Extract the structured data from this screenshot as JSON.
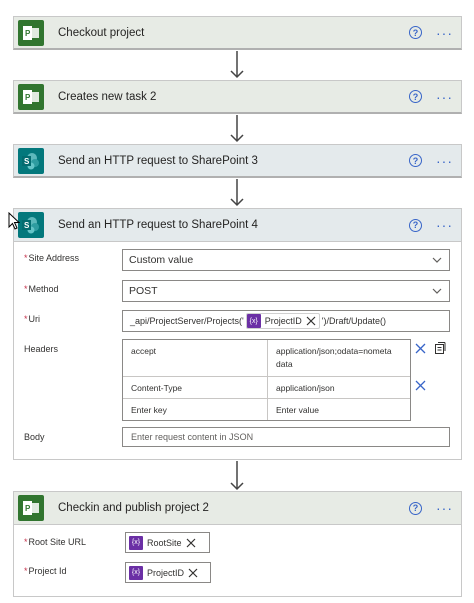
{
  "steps": [
    {
      "title": "Checkout project",
      "icon": "project-icon"
    },
    {
      "title": "Creates new task 2",
      "icon": "project-icon"
    },
    {
      "title": "Send an HTTP request to SharePoint 3",
      "icon": "sharepoint-icon"
    },
    {
      "title": "Send an HTTP request to SharePoint 4",
      "icon": "sharepoint-icon"
    },
    {
      "title": "Checkin and publish project 2",
      "icon": "project-icon"
    }
  ],
  "help_glyph": "?",
  "more_glyph": "···",
  "http_action": {
    "site_address_label": "Site Address",
    "site_address_value": "Custom value",
    "method_label": "Method",
    "method_value": "POST",
    "uri_label": "Uri",
    "uri_prefix": "_api/ProjectServer/Projects('",
    "uri_token": "ProjectID",
    "uri_suffix": "')/Draft/Update()",
    "headers_label": "Headers",
    "headers": [
      {
        "key": "accept",
        "value": "application/json;odata=nometa data"
      },
      {
        "key": "Content-Type",
        "value": "application/json"
      }
    ],
    "key_placeholder": "Enter key",
    "value_placeholder": "Enter value",
    "body_label": "Body",
    "body_placeholder": "Enter request content in JSON"
  },
  "checkin_action": {
    "root_site_label": "Root Site URL",
    "root_site_token": "RootSite",
    "project_id_label": "Project Id",
    "project_id_token": "ProjectID"
  },
  "token_icon_text": "{x}",
  "required_mark": "*",
  "colors": {
    "project_tile": "#31752f",
    "sharepoint_tile": "#03787c",
    "token": "#6b2fa5",
    "accent": "#3865c8"
  }
}
